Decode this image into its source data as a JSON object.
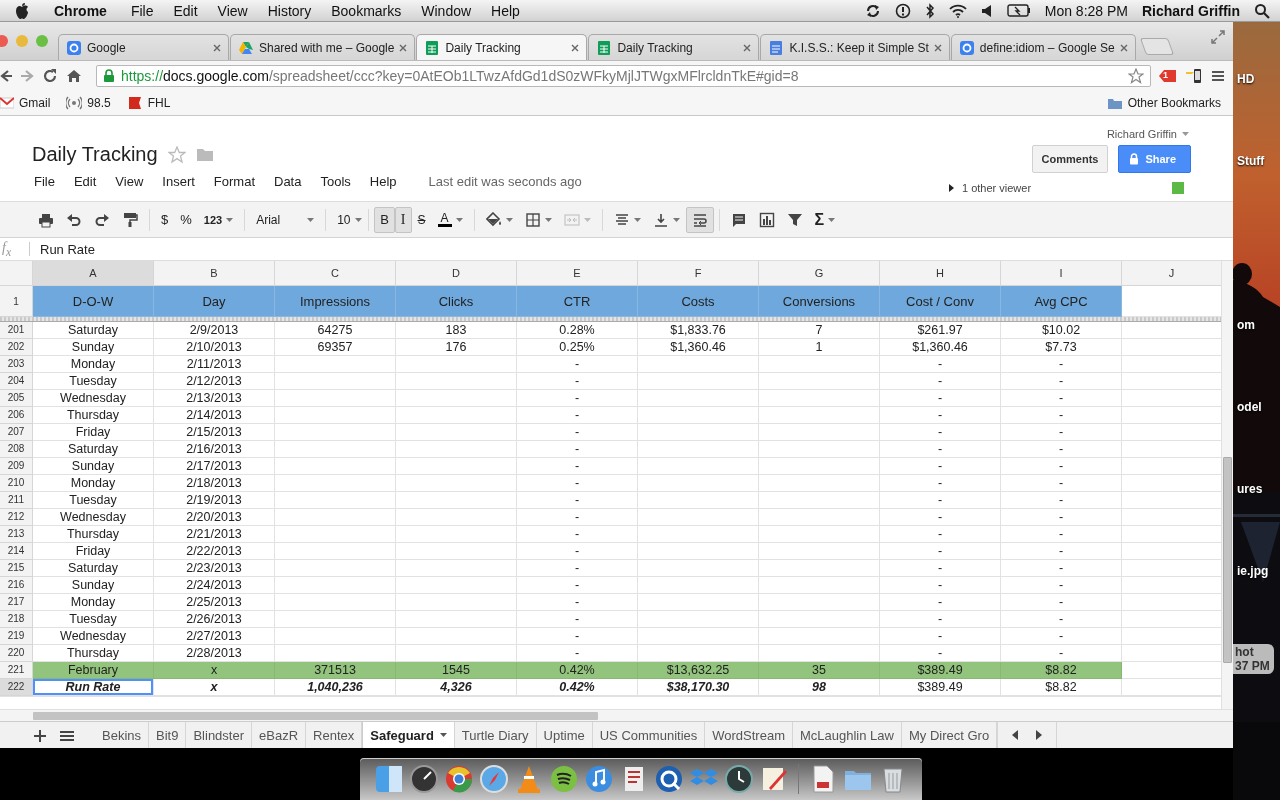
{
  "menubar": {
    "app": "Chrome",
    "menus": [
      "File",
      "Edit",
      "View",
      "History",
      "Bookmarks",
      "Window",
      "Help"
    ],
    "clock": "Mon 8:28 PM",
    "user": "Richard Griffin"
  },
  "browser": {
    "tabs": [
      {
        "kind": "google",
        "title": "Google",
        "selected": false
      },
      {
        "kind": "drive",
        "title": "Shared with me – Google",
        "selected": false
      },
      {
        "kind": "sheet",
        "title": "Daily Tracking",
        "selected": true
      },
      {
        "kind": "sheet",
        "title": "Daily Tracking",
        "selected": false
      },
      {
        "kind": "doc",
        "title": "K.I.S.S.: Keep it Simple St",
        "selected": false
      },
      {
        "kind": "google",
        "title": "define:idiom – Google Se",
        "selected": false
      }
    ],
    "url": "https://docs.google.com/spreadsheet/ccc?key=0AtEOb1LTwzAfdGd1dS0zWFkyMjlJTWgxMFlrcldnTkE#gid=8",
    "extension_badge": "1",
    "bookmarks": [
      {
        "kind": "mail",
        "label": "Gmail"
      },
      {
        "kind": "radio",
        "label": "98.5"
      },
      {
        "kind": "fhl",
        "label": "FHL"
      }
    ],
    "other_bookmarks": "Other Bookmarks"
  },
  "doc": {
    "title": "Daily Tracking",
    "starred": false,
    "menus": [
      "File",
      "Edit",
      "View",
      "Insert",
      "Format",
      "Data",
      "Tools",
      "Help"
    ],
    "last_edit": "Last edit was seconds ago",
    "user": "Richard Griffin",
    "comments": "Comments",
    "share": "Share",
    "viewers": "1 other viewer"
  },
  "toolbar": {
    "currency": "$",
    "percent": "%",
    "number_format": "123",
    "font": "Arial",
    "size": "10",
    "bold": {
      "label": "B",
      "on": true
    },
    "italic": {
      "label": "I",
      "on": true
    },
    "strike": {
      "label": "S",
      "on": false
    },
    "text_color": "A",
    "wrap_on": true,
    "functions": "Σ"
  },
  "formula_bar": {
    "icon": "f$_{x}$",
    "value": "Run Rate"
  },
  "grid": {
    "columns": [
      {
        "label": "A",
        "selected": true
      },
      {
        "label": "B",
        "selected": false
      },
      {
        "label": "C",
        "selected": false
      },
      {
        "label": "D",
        "selected": false
      },
      {
        "label": "E",
        "selected": false
      },
      {
        "label": "F",
        "selected": false
      },
      {
        "label": "G",
        "selected": false
      },
      {
        "label": "H",
        "selected": false
      },
      {
        "label": "I",
        "selected": false
      },
      {
        "label": "J",
        "selected": false
      }
    ],
    "header_row": {
      "number": "1",
      "cells": [
        "D-O-W",
        "Day",
        "Impressions",
        "Clicks",
        "CTR",
        "Costs",
        "Conversions",
        "Cost / Conv",
        "Avg CPC"
      ]
    },
    "rows": [
      {
        "number": "201",
        "kind": "data",
        "selected": false,
        "cells": [
          "Saturday",
          "2/9/2013",
          "64275",
          "183",
          "0.28%",
          "$1,833.76",
          "7",
          "$261.97",
          "$10.02"
        ]
      },
      {
        "number": "202",
        "kind": "data",
        "selected": false,
        "cells": [
          "Sunday",
          "2/10/2013",
          "69357",
          "176",
          "0.25%",
          "$1,360.46",
          "1",
          "$1,360.46",
          "$7.73"
        ]
      },
      {
        "number": "203",
        "kind": "data",
        "selected": false,
        "cells": [
          "Monday",
          "2/11/2013",
          null,
          null,
          "-",
          null,
          null,
          "-",
          "-"
        ]
      },
      {
        "number": "204",
        "kind": "data",
        "selected": false,
        "cells": [
          "Tuesday",
          "2/12/2013",
          null,
          null,
          "-",
          null,
          null,
          "-",
          "-"
        ]
      },
      {
        "number": "205",
        "kind": "data",
        "selected": false,
        "cells": [
          "Wednesday",
          "2/13/2013",
          null,
          null,
          "-",
          null,
          null,
          "-",
          "-"
        ]
      },
      {
        "number": "206",
        "kind": "data",
        "selected": false,
        "cells": [
          "Thursday",
          "2/14/2013",
          null,
          null,
          "-",
          null,
          null,
          "-",
          "-"
        ]
      },
      {
        "number": "207",
        "kind": "data",
        "selected": false,
        "cells": [
          "Friday",
          "2/15/2013",
          null,
          null,
          "-",
          null,
          null,
          "-",
          "-"
        ]
      },
      {
        "number": "208",
        "kind": "data",
        "selected": false,
        "cells": [
          "Saturday",
          "2/16/2013",
          null,
          null,
          "-",
          null,
          null,
          "-",
          "-"
        ]
      },
      {
        "number": "209",
        "kind": "data",
        "selected": false,
        "cells": [
          "Sunday",
          "2/17/2013",
          null,
          null,
          "-",
          null,
          null,
          "-",
          "-"
        ]
      },
      {
        "number": "210",
        "kind": "data",
        "selected": false,
        "cells": [
          "Monday",
          "2/18/2013",
          null,
          null,
          "-",
          null,
          null,
          "-",
          "-"
        ]
      },
      {
        "number": "211",
        "kind": "data",
        "selected": false,
        "cells": [
          "Tuesday",
          "2/19/2013",
          null,
          null,
          "-",
          null,
          null,
          "-",
          "-"
        ]
      },
      {
        "number": "212",
        "kind": "data",
        "selected": false,
        "cells": [
          "Wednesday",
          "2/20/2013",
          null,
          null,
          "-",
          null,
          null,
          "-",
          "-"
        ]
      },
      {
        "number": "213",
        "kind": "data",
        "selected": false,
        "cells": [
          "Thursday",
          "2/21/2013",
          null,
          null,
          "-",
          null,
          null,
          "-",
          "-"
        ]
      },
      {
        "number": "214",
        "kind": "data",
        "selected": false,
        "cells": [
          "Friday",
          "2/22/2013",
          null,
          null,
          "-",
          null,
          null,
          "-",
          "-"
        ]
      },
      {
        "number": "215",
        "kind": "data",
        "selected": false,
        "cells": [
          "Saturday",
          "2/23/2013",
          null,
          null,
          "-",
          null,
          null,
          "-",
          "-"
        ]
      },
      {
        "number": "216",
        "kind": "data",
        "selected": false,
        "cells": [
          "Sunday",
          "2/24/2013",
          null,
          null,
          "-",
          null,
          null,
          "-",
          "-"
        ]
      },
      {
        "number": "217",
        "kind": "data",
        "selected": false,
        "cells": [
          "Monday",
          "2/25/2013",
          null,
          null,
          "-",
          null,
          null,
          "-",
          "-"
        ]
      },
      {
        "number": "218",
        "kind": "data",
        "selected": false,
        "cells": [
          "Tuesday",
          "2/26/2013",
          null,
          null,
          "-",
          null,
          null,
          "-",
          "-"
        ]
      },
      {
        "number": "219",
        "kind": "data",
        "selected": false,
        "cells": [
          "Wednesday",
          "2/27/2013",
          null,
          null,
          "-",
          null,
          null,
          "-",
          "-"
        ]
      },
      {
        "number": "220",
        "kind": "data",
        "selected": false,
        "cells": [
          "Thursday",
          "2/28/2013",
          null,
          null,
          "-",
          null,
          null,
          "-",
          "-"
        ]
      },
      {
        "number": "221",
        "kind": "total",
        "selected": false,
        "cells": [
          "February",
          "x",
          "371513",
          "1545",
          "0.42%",
          "$13,632.25",
          "35",
          "$389.49",
          "$8.82"
        ]
      },
      {
        "number": "222",
        "kind": "run_rate",
        "selected": true,
        "cells": [
          {
            "text": "Run Rate",
            "bold_italic": true,
            "selected": true
          },
          {
            "text": "x",
            "bold_italic": true,
            "selected": false
          },
          {
            "text": "1,040,236",
            "bold_italic": true,
            "selected": false
          },
          {
            "text": "4,326",
            "bold_italic": true,
            "selected": false
          },
          {
            "text": "0.42%",
            "bold_italic": true,
            "selected": false
          },
          {
            "text": "$38,170.30",
            "bold_italic": true,
            "selected": false
          },
          {
            "text": "98",
            "bold_italic": true,
            "selected": false
          },
          {
            "text": "$389.49",
            "bold_italic": false,
            "selected": false
          },
          {
            "text": "$8.82",
            "bold_italic": false,
            "selected": false
          }
        ]
      }
    ]
  },
  "sheets": [
    {
      "name": "Bekins",
      "selected": false
    },
    {
      "name": "Bit9",
      "selected": false
    },
    {
      "name": "Blindster",
      "selected": false
    },
    {
      "name": "eBazR",
      "selected": false
    },
    {
      "name": "Rentex",
      "selected": false
    },
    {
      "name": "Safeguard",
      "selected": true
    },
    {
      "name": "Turtle Diary",
      "selected": false
    },
    {
      "name": "Uptime",
      "selected": false
    },
    {
      "name": "US Communities",
      "selected": false
    },
    {
      "name": "WordStream",
      "selected": false
    },
    {
      "name": "McLaughlin Law",
      "selected": false
    },
    {
      "name": "My Direct Gro",
      "selected": false
    }
  ],
  "desktop": {
    "labels": [
      "HD",
      "Stuff",
      "om",
      "odel",
      "ures",
      "ie.jpg"
    ],
    "screenshot_label": [
      "hot",
      "37 PM"
    ]
  }
}
